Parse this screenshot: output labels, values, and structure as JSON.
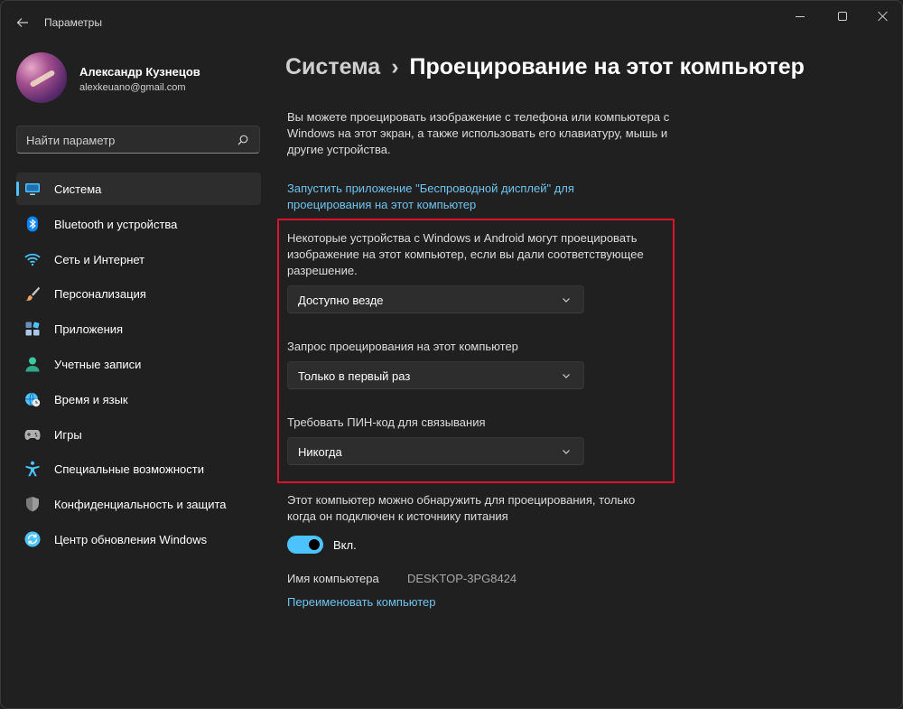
{
  "window": {
    "app_title": "Параметры",
    "back_icon": "arrow-left-icon"
  },
  "profile": {
    "name": "Александр Кузнецов",
    "email": "alexkeuano@gmail.com"
  },
  "search": {
    "placeholder": "Найти параметр",
    "icon": "search-icon"
  },
  "sidebar": {
    "active_index": 0,
    "items": [
      {
        "label": "Система",
        "icon": "monitor-icon",
        "color": "#4cc2ff"
      },
      {
        "label": "Bluetooth и устройства",
        "icon": "bluetooth-icon",
        "color": "#0a84ff"
      },
      {
        "label": "Сеть и Интернет",
        "icon": "wifi-icon",
        "color": "#4cc2ff"
      },
      {
        "label": "Персонализация",
        "icon": "brush-icon",
        "color": "#f0a060"
      },
      {
        "label": "Приложения",
        "icon": "apps-icon",
        "color": "#a8c8e8"
      },
      {
        "label": "Учетные записи",
        "icon": "person-icon",
        "color": "#3cc8a0"
      },
      {
        "label": "Время и язык",
        "icon": "globe-clock-icon",
        "color": "#4cc2ff"
      },
      {
        "label": "Игры",
        "icon": "gamepad-icon",
        "color": "#b0b0b0"
      },
      {
        "label": "Специальные возможности",
        "icon": "accessibility-icon",
        "color": "#4cc2ff"
      },
      {
        "label": "Конфиденциальность и защита",
        "icon": "shield-icon",
        "color": "#9a9a9a"
      },
      {
        "label": "Центр обновления Windows",
        "icon": "sync-icon",
        "color": "#4cc2ff"
      }
    ]
  },
  "main": {
    "breadcrumb_parent": "Система",
    "breadcrumb_separator": "›",
    "page_title": "Проецирование на этот компьютер",
    "description": "Вы можете проецировать изображение с телефона или компьютера с Windows на этот экран, а также использовать его клавиатуру, мышь и другие устройства.",
    "launch_link": "Запустить приложение \"Беспроводной дисплей\" для проецирования на этот компьютер",
    "permission_text": "Некоторые устройства с Windows и Android могут проецировать изображение на этот компьютер, если вы дали соответствующее разрешение.",
    "availability_value": "Доступно везде",
    "request_label": "Запрос проецирования на этот компьютер",
    "request_value": "Только в первый раз",
    "pin_label": "Требовать ПИН-код для связывания",
    "pin_value": "Никогда",
    "discover_text": "Этот компьютер можно обнаружить для проецирования, только когда он подключен к источнику питания",
    "toggle_state": "Вкл.",
    "toggle_on": true,
    "pc_name_label": "Имя компьютера",
    "pc_name_value": "DESKTOP-3PG8424",
    "rename_link": "Переименовать компьютер"
  },
  "colors": {
    "accent": "#4cc2ff",
    "link": "#6fc3f0",
    "highlight_border": "#e0112a",
    "background": "#202020"
  }
}
